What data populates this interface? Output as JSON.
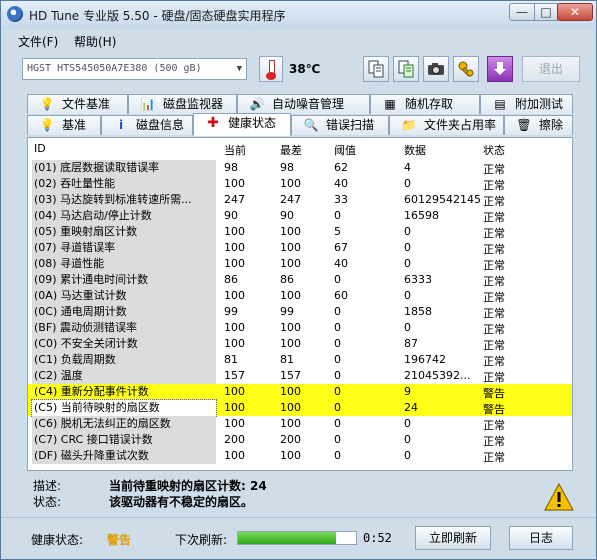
{
  "window": {
    "title": "HD Tune 专业版 5.50 - 硬盘/固态硬盘实用程序",
    "min_glyph": "—",
    "max_glyph": "□",
    "close_glyph": "✕"
  },
  "menu": {
    "file": "文件(F)",
    "help": "帮助(H)"
  },
  "toolbar": {
    "drive": "HGST HTS545050A7E380 (500 gB)",
    "temperature": "38℃",
    "exit_label": "退出"
  },
  "tabs_row1": [
    {
      "label": "文件基准",
      "icon": "file-benchmark-icon"
    },
    {
      "label": "磁盘监视器",
      "icon": "disk-monitor-icon"
    },
    {
      "label": "自动噪音管理",
      "icon": "speaker-icon"
    },
    {
      "label": "随机存取",
      "icon": "random-access-icon"
    },
    {
      "label": "附加测试",
      "icon": "extra-tests-icon"
    }
  ],
  "tabs_row2": [
    {
      "label": "基准",
      "icon": "benchmark-icon"
    },
    {
      "label": "磁盘信息",
      "icon": "info-icon"
    },
    {
      "label": "健康状态",
      "icon": "health-cross-icon"
    },
    {
      "label": "错误扫描",
      "icon": "magnifier-icon"
    },
    {
      "label": "文件夹占用率",
      "icon": "folder-icon"
    },
    {
      "label": "擦除",
      "icon": "trash-icon"
    }
  ],
  "table": {
    "headers": [
      "ID",
      "当前",
      "最差",
      "阈值",
      "数据",
      "状态"
    ],
    "rows": [
      {
        "id": "(01) 底层数据读取错误率",
        "cur": "98",
        "worst": "98",
        "thr": "62",
        "data": "4",
        "status": "正常"
      },
      {
        "id": "(02) 吞吐量性能",
        "cur": "100",
        "worst": "100",
        "thr": "40",
        "data": "0",
        "status": "正常"
      },
      {
        "id": "(03) 马达旋转到标准转速所需...",
        "cur": "247",
        "worst": "247",
        "thr": "33",
        "data": "60129542145",
        "status": "正常"
      },
      {
        "id": "(04) 马达启动/停止计数",
        "cur": "90",
        "worst": "90",
        "thr": "0",
        "data": "16598",
        "status": "正常"
      },
      {
        "id": "(05) 重映射扇区计数",
        "cur": "100",
        "worst": "100",
        "thr": "5",
        "data": "0",
        "status": "正常"
      },
      {
        "id": "(07) 寻道错误率",
        "cur": "100",
        "worst": "100",
        "thr": "67",
        "data": "0",
        "status": "正常"
      },
      {
        "id": "(08) 寻道性能",
        "cur": "100",
        "worst": "100",
        "thr": "40",
        "data": "0",
        "status": "正常"
      },
      {
        "id": "(09) 累计通电时间计数",
        "cur": "86",
        "worst": "86",
        "thr": "0",
        "data": "6333",
        "status": "正常"
      },
      {
        "id": "(0A) 马达重试计数",
        "cur": "100",
        "worst": "100",
        "thr": "60",
        "data": "0",
        "status": "正常"
      },
      {
        "id": "(0C) 通电周期计数",
        "cur": "99",
        "worst": "99",
        "thr": "0",
        "data": "1858",
        "status": "正常"
      },
      {
        "id": "(BF) 震动侦测错误率",
        "cur": "100",
        "worst": "100",
        "thr": "0",
        "data": "0",
        "status": "正常"
      },
      {
        "id": "(C0) 不安全关闭计数",
        "cur": "100",
        "worst": "100",
        "thr": "0",
        "data": "87",
        "status": "正常"
      },
      {
        "id": "(C1) 负载周期数",
        "cur": "81",
        "worst": "81",
        "thr": "0",
        "data": "196742",
        "status": "正常"
      },
      {
        "id": "(C2) 温度",
        "cur": "157",
        "worst": "157",
        "thr": "0",
        "data": "21045392...",
        "status": "正常"
      },
      {
        "id": "(C4) 重新分配事件计数",
        "cur": "100",
        "worst": "100",
        "thr": "0",
        "data": "9",
        "status": "警告"
      },
      {
        "id": "(C5) 当前待映射的扇区数",
        "cur": "100",
        "worst": "100",
        "thr": "0",
        "data": "24",
        "status": "警告"
      },
      {
        "id": "(C6) 脱机无法纠正的扇区数",
        "cur": "100",
        "worst": "100",
        "thr": "0",
        "data": "0",
        "status": "正常"
      },
      {
        "id": "(C7) CRC 接口错误计数",
        "cur": "200",
        "worst": "200",
        "thr": "0",
        "data": "0",
        "status": "正常"
      },
      {
        "id": "(DF) 磁头升降重试次数",
        "cur": "100",
        "worst": "100",
        "thr": "0",
        "data": "0",
        "status": "正常"
      }
    ]
  },
  "description": {
    "desc_label": "描述:",
    "desc_value": "当前待重映射的扇区计数:  24",
    "status_label": "状态:",
    "status_value": "该驱动器有不稳定的扇区。"
  },
  "statusbar": {
    "health_label": "健康状态:",
    "health_value": "警告",
    "refresh_label": "下次刷新:",
    "refresh_progress": 0.83,
    "timer": "0:52",
    "refresh_button": "立即刷新",
    "log_button": "日志"
  },
  "colors": {
    "warning_row": "#ffff18",
    "health_warning": "#e0a000"
  }
}
